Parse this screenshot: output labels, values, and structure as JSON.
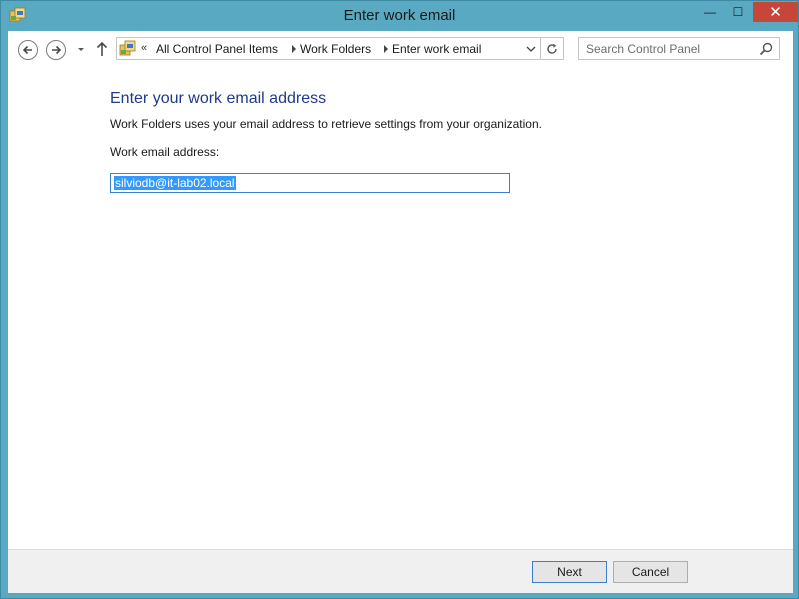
{
  "window": {
    "title": "Enter work email",
    "minimize_glyph": "—",
    "maximize_glyph": "☐",
    "close_glyph": "✕"
  },
  "navigation": {
    "overflow_chevron": "«",
    "breadcrumbs": [
      "All Control Panel Items",
      "Work Folders",
      "Enter work email"
    ],
    "search_placeholder": "Search Control Panel"
  },
  "content": {
    "heading": "Enter your work email address",
    "description": "Work Folders uses your email address to retrieve settings from your organization.",
    "email_label": "Work email address:",
    "email_value": "silviodb@it-lab02.local"
  },
  "footer": {
    "next_label": "Next",
    "cancel_label": "Cancel"
  },
  "icons": {
    "title_icon": "control-panel-icon",
    "back": "back-arrow-icon",
    "forward": "forward-arrow-icon",
    "recent": "chevron-down-icon",
    "up": "up-arrow-icon",
    "address": "control-panel-icon",
    "refresh": "refresh-icon",
    "search": "search-icon"
  },
  "colors": {
    "titlebar": "#5aa9c2",
    "heading": "#1e3a8a",
    "selection": "#3399ff",
    "close_button": "#c7463a"
  }
}
